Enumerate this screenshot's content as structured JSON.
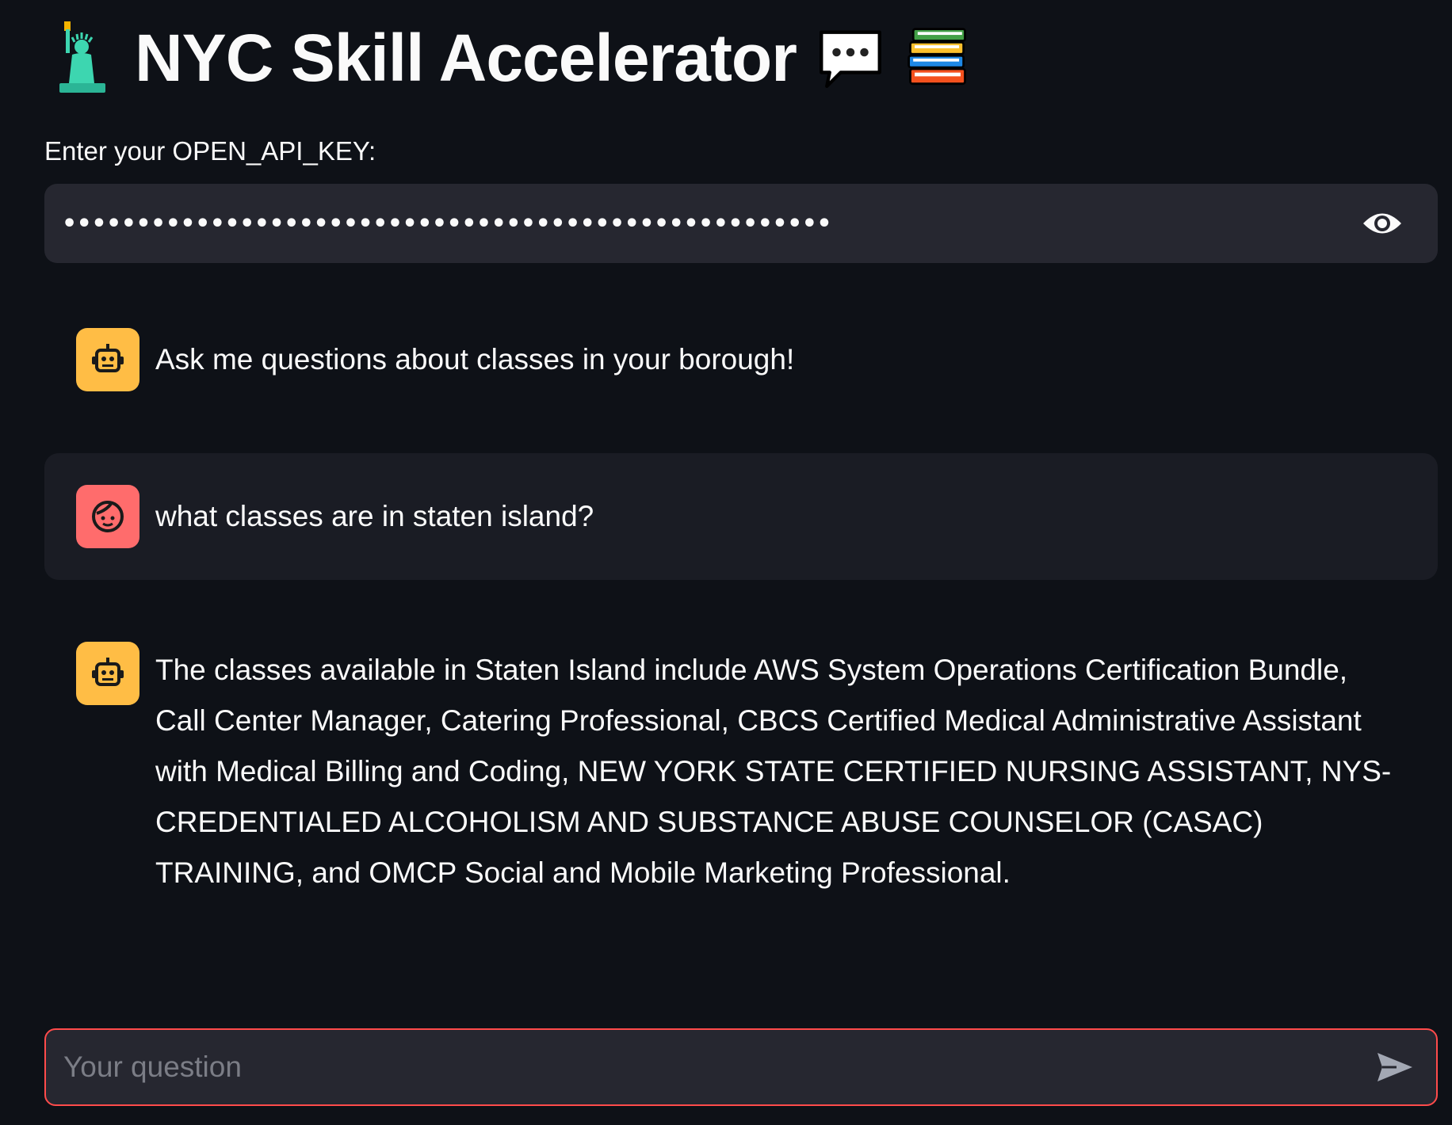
{
  "header": {
    "title": "NYC Skill Accelerator",
    "leading_icon": "statue-of-liberty-icon",
    "trailing_icons": [
      "speech-bubble-icon",
      "books-icon"
    ]
  },
  "api_key": {
    "label": "Enter your OPEN_API_KEY:",
    "masked_value": "••••••••••••••••••••••••••••••••••••••••••••••••••••",
    "toggle_icon": "eye-icon"
  },
  "messages": [
    {
      "role": "assistant",
      "avatar_icon": "robot-icon",
      "text": "Ask me questions about classes in your borough!"
    },
    {
      "role": "user",
      "avatar_icon": "face-icon",
      "text": "what classes are in staten island?"
    },
    {
      "role": "assistant",
      "avatar_icon": "robot-icon",
      "text": "The classes available in Staten Island include AWS System Operations Certification Bundle, Call Center Manager, Catering Professional, CBCS Certified Medical Administrative Assistant with Medical Billing and Coding, NEW YORK STATE CERTIFIED NURSING ASSISTANT, NYS-CREDENTIALED ALCOHOLISM AND SUBSTANCE ABUSE COUNSELOR (CASAC) TRAINING, and OMCP Social and Mobile Marketing Professional."
    }
  ],
  "chat_input": {
    "placeholder": "Your question",
    "value": "",
    "send_icon": "send-icon"
  },
  "colors": {
    "background": "#0e1117",
    "input_bg": "#262730",
    "user_message_bg": "#1a1c24",
    "assistant_avatar": "#ffbd45",
    "user_avatar": "#ff6c6c",
    "focus_border": "#ff4b4b"
  }
}
